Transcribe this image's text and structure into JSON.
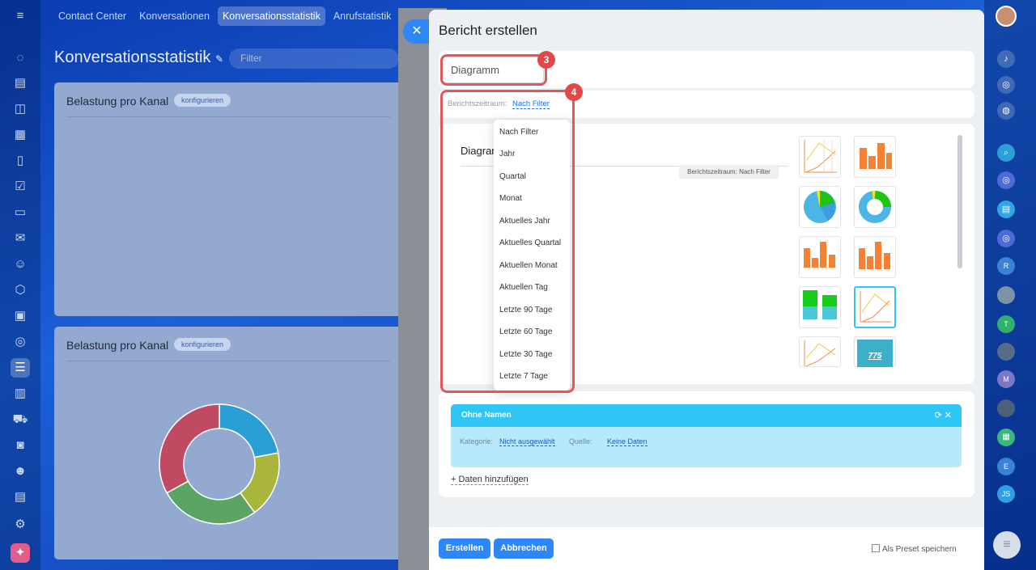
{
  "topnav": {
    "tabs": [
      "Contact Center",
      "Konversationen",
      "Konversationsstatistik",
      "Anrufstatistik"
    ]
  },
  "page": {
    "title": "Konversationsstatistik",
    "filter_placeholder": "Filter"
  },
  "cards": [
    {
      "title": "Belastung pro Kanal",
      "button": "konfigurieren"
    },
    {
      "title": "Belastung pro Kanal",
      "button": "konfigurieren"
    }
  ],
  "donut_values": [
    22,
    18,
    27,
    33
  ],
  "donut_colors": [
    "#2a9fd6",
    "#a9b53c",
    "#5aa464",
    "#c04a62"
  ],
  "slider": {
    "title": "Bericht erstellen",
    "name_value": "Diagramm",
    "period_label": "Berichtszeitraum:",
    "period_value": "Nach Filter",
    "period_options": [
      "Nach Filter",
      "Jahr",
      "Quartal",
      "Monat",
      "Aktuelles Jahr",
      "Aktuelles Quartal",
      "Aktuellen Monat",
      "Aktuellen Tag",
      "Letzte 90 Tage",
      "Letzte 60 Tage",
      "Letzte 30 Tage",
      "Letzte 7 Tage"
    ],
    "preview_title": "Diagramm",
    "preview_tag": "Berichtszeitraum: Nach Filter",
    "badges": [
      "3",
      "4"
    ],
    "widget_big_number": "775",
    "dataset": {
      "name": "Ohne Namen",
      "category_label": "Kategorie:",
      "category_value": "Nicht ausgewählt",
      "source_label": "Quelle:",
      "source_value": "Keine Daten"
    },
    "add_data": "+ Daten hinzufügen",
    "create_button": "Erstellen",
    "cancel_button": "Abbrechen",
    "preset_label": "Als Preset speichern"
  },
  "user_initials": [
    "R",
    "T",
    "M",
    "E",
    "JS"
  ],
  "colors": {
    "accent": "#2f86f6",
    "highlight": "#e45757",
    "dataset_header": "#2fc6f6"
  }
}
